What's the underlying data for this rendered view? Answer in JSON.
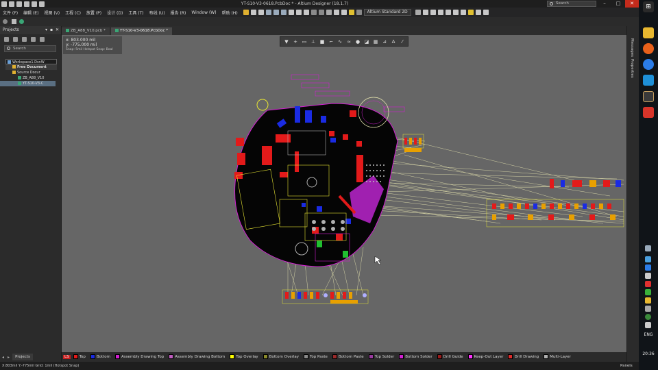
{
  "window": {
    "title": "YT-S10-V3-0618.PcbDoc * - Altium Designer (18.1.7)",
    "search_placeholder": "Search"
  },
  "menu": {
    "items": [
      "文件 (F)",
      "编辑 (E)",
      "视图 (V)",
      "工程 (C)",
      "放置 (P)",
      "设计 (D)",
      "工具 (T)",
      "布线 (U)",
      "报告 (R)",
      "Window (W)",
      "帮助 (H)"
    ],
    "view_mode": "Altium Standard 2D"
  },
  "projects_panel": {
    "title": "Projects",
    "search_placeholder": "Search",
    "tree": {
      "workspace": "Workspace1.DsnW",
      "free_documents": "Free Document",
      "source_documents": "Source Docur",
      "file1": "ZB_A88_V10",
      "file2": "YT-S10-V3-C"
    },
    "bottom_tab": "Projects"
  },
  "doc_tabs": [
    "ZB_A88_V10.pcb *",
    "YT-S10-V3-0618.PcbDoc *"
  ],
  "coords": {
    "x": "x:    803.000 mil",
    "y": "y:  -775.000 mil",
    "snap": "Snap: 5mil Hotspot Snap: Boal"
  },
  "right_panels": [
    "Messages",
    "Properties"
  ],
  "layers": [
    {
      "name": "Top",
      "color": "#e31a1a"
    },
    {
      "name": "Bottom",
      "color": "#1a2be3"
    },
    {
      "name": "Assembly Drawing Top",
      "color": "#d21fd2"
    },
    {
      "name": "Assembly Drawing Bottom",
      "color": "#c05cc0"
    },
    {
      "name": "Top Overlay",
      "color": "#ffff00"
    },
    {
      "name": "Bottom Overlay",
      "color": "#8a8a2a"
    },
    {
      "name": "Top Paste",
      "color": "#8a8a8a"
    },
    {
      "name": "Bottom Paste",
      "color": "#9a2a2a"
    },
    {
      "name": "Top Solder",
      "color": "#9a3aa0"
    },
    {
      "name": "Bottom Solder",
      "color": "#d21fd2"
    },
    {
      "name": "Drill Guide",
      "color": "#9a1a1a"
    },
    {
      "name": "Keep-Out Layer",
      "color": "#ff30ff"
    },
    {
      "name": "Drill Drawing",
      "color": "#e02a2a"
    },
    {
      "name": "Multi-Layer",
      "color": "#b0b0b0"
    }
  ],
  "layer_ls": "LS",
  "status": {
    "left": "X:803mil Y:-775mil   Grid: 1mil   (Hotspot Snap)",
    "panels": "Panels"
  },
  "taskbar": {
    "lang": "ENG",
    "time": "20:36"
  }
}
